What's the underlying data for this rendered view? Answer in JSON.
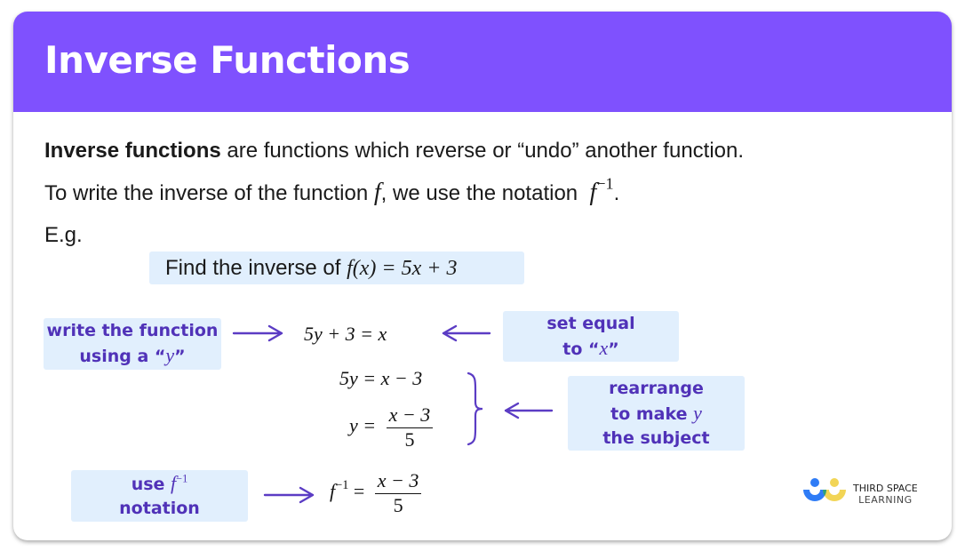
{
  "header": {
    "title": "Inverse Functions",
    "color": "#7f51fe"
  },
  "intro": {
    "bold_term": "Inverse functions",
    "line1_rest": " are functions which reverse or “undo” another function.",
    "line2_before": "To write the inverse of the function ",
    "line2_f": "f",
    "line2_mid": ", we use the notation ",
    "line2_notation_base": "f",
    "line2_notation_sup": "−1",
    "line2_end": ".",
    "eg": "E.g."
  },
  "example": {
    "prefix": "Find the inverse of ",
    "function": "f(x) = 5x + 3"
  },
  "steps": {
    "step1": "5y + 3 = x",
    "step2": "5y = x − 3",
    "step3_lhs": "y = ",
    "step3_num": "x − 3",
    "step3_den": "5",
    "step4_lhs_base": "f",
    "step4_lhs_sup": "−1",
    "step4_eq": " = ",
    "step4_num": "x − 3",
    "step4_den": "5"
  },
  "notes": {
    "write_function": {
      "line1": "write the function",
      "line2_pre": "using a “",
      "line2_var": "y",
      "line2_post": "”"
    },
    "set_equal": {
      "line1": "set equal",
      "line2_pre": "to “",
      "line2_var": "x",
      "line2_post": "”"
    },
    "rearrange": {
      "line1": "rearrange",
      "line2_pre": "to make ",
      "line2_var": "y",
      "line3": "the subject"
    },
    "use_notation": {
      "line1_pre": "use ",
      "line1_var": "f",
      "line1_sup": "−1",
      "line2": "notation"
    }
  },
  "colors": {
    "note_bg": "#e1effd",
    "note_text": "#5032b8",
    "arrow": "#5b3cc4"
  },
  "logo": {
    "line1": "THIRD SPACE",
    "line2": "LEARNING"
  }
}
